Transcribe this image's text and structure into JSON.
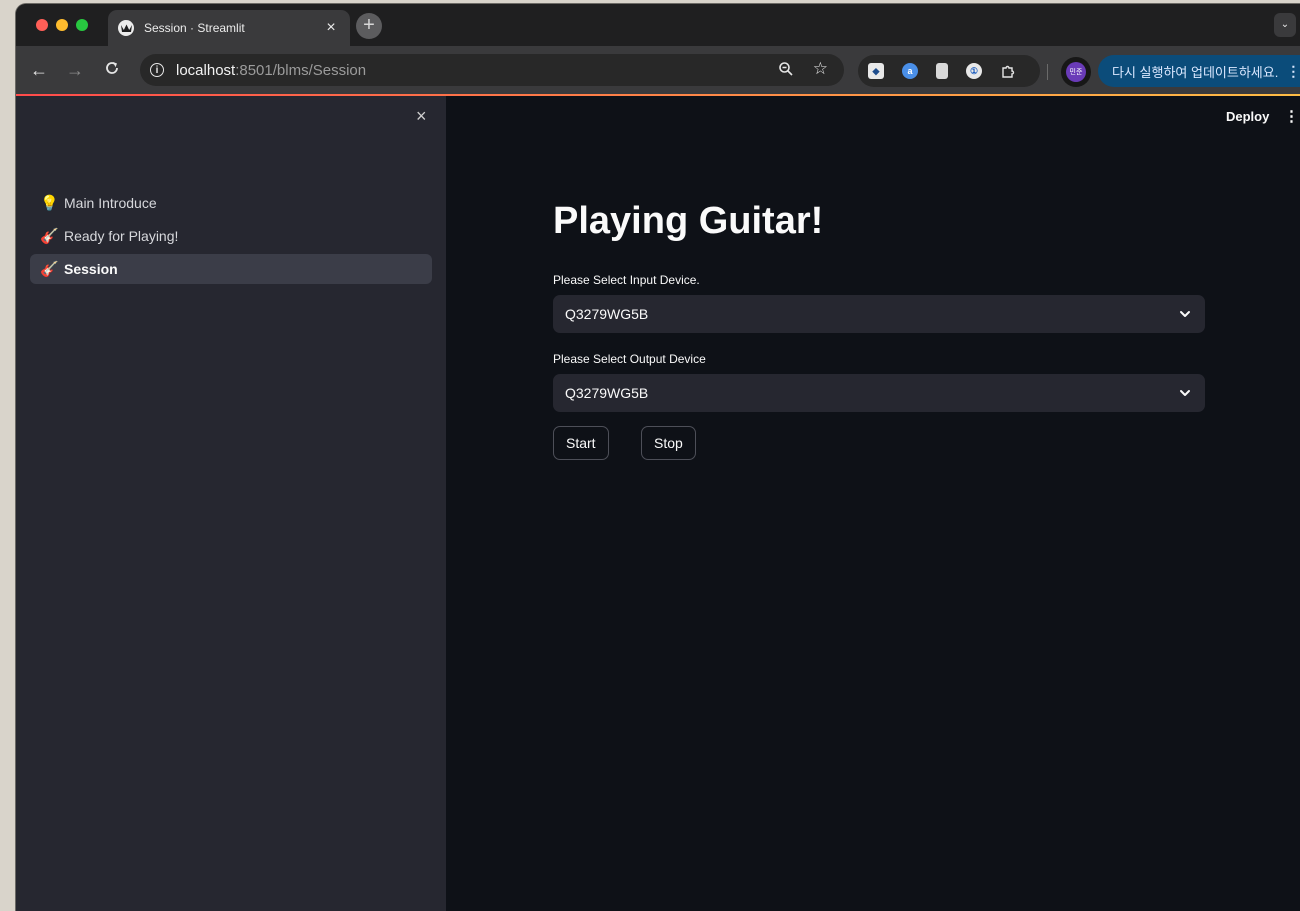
{
  "browser": {
    "tab": {
      "title": "Session · Streamlit",
      "close_glyph": "×",
      "new_tab_glyph": "+"
    },
    "tab_menu_glyph": "⌄",
    "address": {
      "host": "localhost",
      "path": ":8501/blms/Session"
    },
    "update_button": "다시 실행하여 업데이트하세요.",
    "profile_initials": "민준",
    "colors": {
      "close": "#ff5f57",
      "minimize": "#febc2e",
      "maximize": "#28c840"
    }
  },
  "sidebar": {
    "close_glyph": "×",
    "items": [
      {
        "emoji": "💡",
        "label": "Main Introduce",
        "active": false
      },
      {
        "emoji": "🎸",
        "label": "Ready for Playing!",
        "active": false
      },
      {
        "emoji": "🎸",
        "label": "Session",
        "active": true
      }
    ]
  },
  "header": {
    "deploy_label": "Deploy",
    "menu_glyph": "⋮"
  },
  "main": {
    "title": "Playing Guitar!",
    "input_device": {
      "label": "Please Select Input Device.",
      "value": "Q3279WG5B"
    },
    "output_device": {
      "label": "Please Select Output Device",
      "value": "Q3279WG5B"
    },
    "start_label": "Start",
    "stop_label": "Stop"
  }
}
